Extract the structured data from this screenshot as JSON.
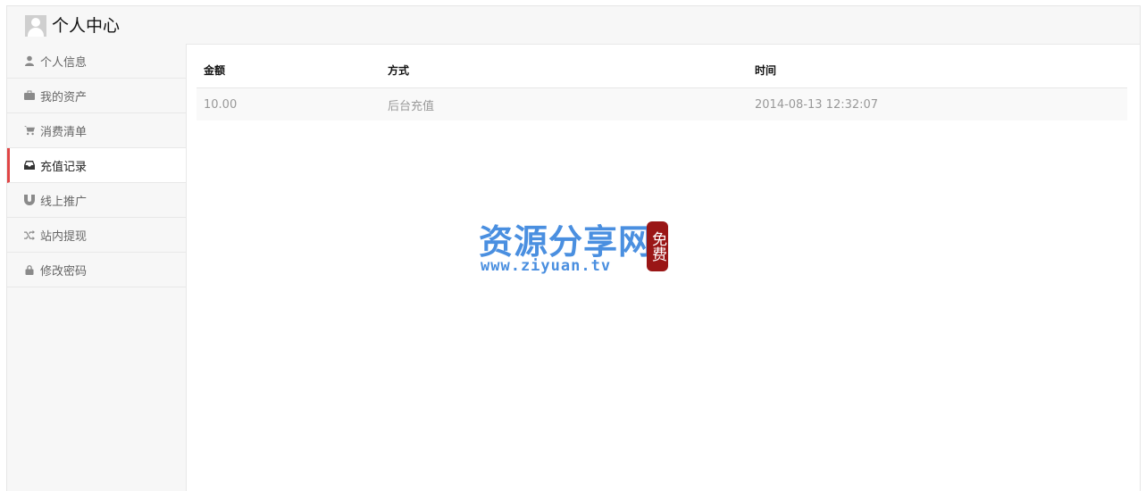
{
  "header": {
    "title": "个人中心"
  },
  "sidebar": {
    "items": [
      {
        "label": "个人信息",
        "icon": "user-icon",
        "active": false
      },
      {
        "label": "我的资产",
        "icon": "briefcase-icon",
        "active": false
      },
      {
        "label": "消费清单",
        "icon": "cart-icon",
        "active": false
      },
      {
        "label": "充值记录",
        "icon": "inbox-icon",
        "active": true
      },
      {
        "label": "线上推广",
        "icon": "magnet-icon",
        "active": false
      },
      {
        "label": "站内提现",
        "icon": "shuffle-icon",
        "active": false
      },
      {
        "label": "修改密码",
        "icon": "lock-icon",
        "active": false
      }
    ],
    "active_color": "#e04545"
  },
  "table": {
    "headers": [
      "金额",
      "方式",
      "时间"
    ],
    "rows": [
      [
        "10.00",
        "后台充值",
        "2014-08-13 12:32:07"
      ]
    ]
  },
  "watermark": {
    "title": "资源分享网",
    "url": "www.ziyuan.tv",
    "stamp": "免费"
  }
}
